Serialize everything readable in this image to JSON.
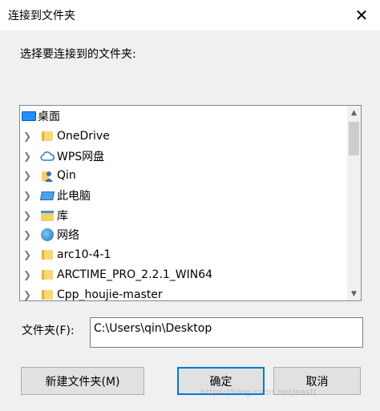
{
  "window": {
    "title": "连接到文件夹",
    "close_glyph": "✕"
  },
  "prompt": "选择要连接到的文件夹:",
  "tree": {
    "root": {
      "label": "桌面",
      "icon": "desktop-icon"
    },
    "items": [
      {
        "label": "OneDrive",
        "icon": "folder-icon"
      },
      {
        "label": "WPS网盘",
        "icon": "cloud-icon"
      },
      {
        "label": "Qin",
        "icon": "user-folder-icon"
      },
      {
        "label": "此电脑",
        "icon": "computer-icon"
      },
      {
        "label": "库",
        "icon": "library-icon"
      },
      {
        "label": "网络",
        "icon": "network-icon"
      },
      {
        "label": "arc10-4-1",
        "icon": "folder-icon"
      },
      {
        "label": "ARCTIME_PRO_2.2.1_WIN64",
        "icon": "folder-icon"
      },
      {
        "label": "Cpp_houjie-master",
        "icon": "folder-icon"
      }
    ]
  },
  "folder_field": {
    "label": "文件夹(F):",
    "value": "C:\\Users\\qin\\Desktop"
  },
  "buttons": {
    "new_folder": "新建文件夹(M)",
    "ok": "确定",
    "cancel": "取消"
  },
  "watermark": "https://blog.csdn.net/eastl"
}
